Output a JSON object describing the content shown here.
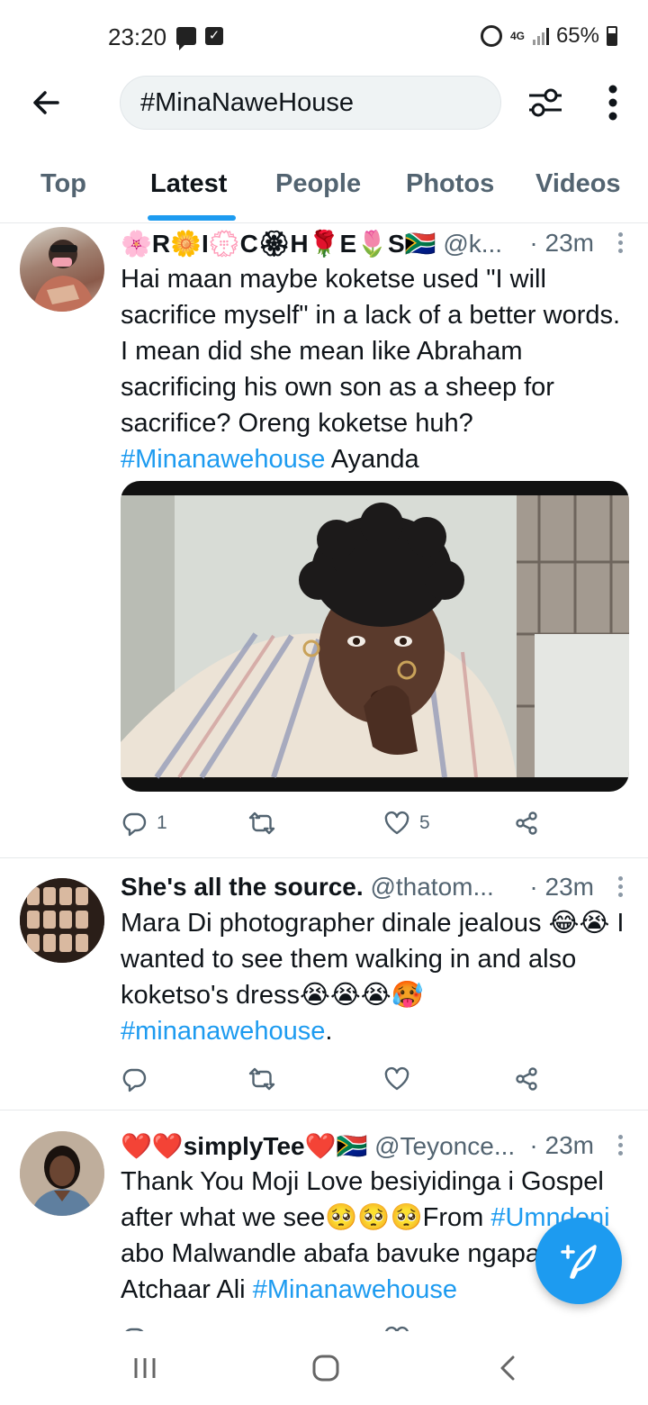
{
  "status_bar": {
    "time": "23:20",
    "network": "4G",
    "battery": "65%"
  },
  "header": {
    "search_value": "#MinaNaweHouse",
    "icons": [
      "back-arrow-icon",
      "filter-sliders-icon",
      "more-vertical-icon"
    ]
  },
  "tabs": [
    {
      "label": "Top",
      "active": false
    },
    {
      "label": "Latest",
      "active": true
    },
    {
      "label": "People",
      "active": false
    },
    {
      "label": "Photos",
      "active": false
    },
    {
      "label": "Videos",
      "active": false
    }
  ],
  "tweets": [
    {
      "name": "🌸R🌼I💮C🏵H🌹E🌷S🇿🇦",
      "handle": "@k...",
      "time": "· 23m",
      "text_before": "Hai maan maybe koketse used \"I will sacrifice myself\" in a lack of a better words. I mean did she mean like Abraham sacrificing his own son as a sheep for sacrifice? Oreng koketse huh? ",
      "hashtag": "#Minanawehouse",
      "text_after": " Ayanda",
      "replies": "1",
      "retweets": "",
      "likes": "5"
    },
    {
      "name": "She's all the source.",
      "handle": "@thatom...",
      "time": "· 23m",
      "text_before": "Mara Di photographer dinale jealous 😂😭 I wanted to see them walking in and also koketso's dress😭😭😭🥵 ",
      "hashtag": "#minanawehouse",
      "text_after": ".",
      "replies": "",
      "retweets": "",
      "likes": ""
    },
    {
      "name": "❤️❤️simplyTee❤️🇿🇦",
      "handle": "@Teyonce...",
      "time": "· 23m",
      "text_before": "Thank You Moji Love besiyidinga i Gospel after what we see🥺🥺🥺From ",
      "hashtag": "#Umndeni",
      "text_middle": " abo Malwandle abafa bavuke ngapa Atchaar Ali ",
      "hashtag2": "#Minanawehouse",
      "replies": "",
      "retweets": "",
      "likes": ""
    }
  ],
  "colors": {
    "accent": "#1d9bf0",
    "text": "#0f1419",
    "secondary": "#536471"
  }
}
